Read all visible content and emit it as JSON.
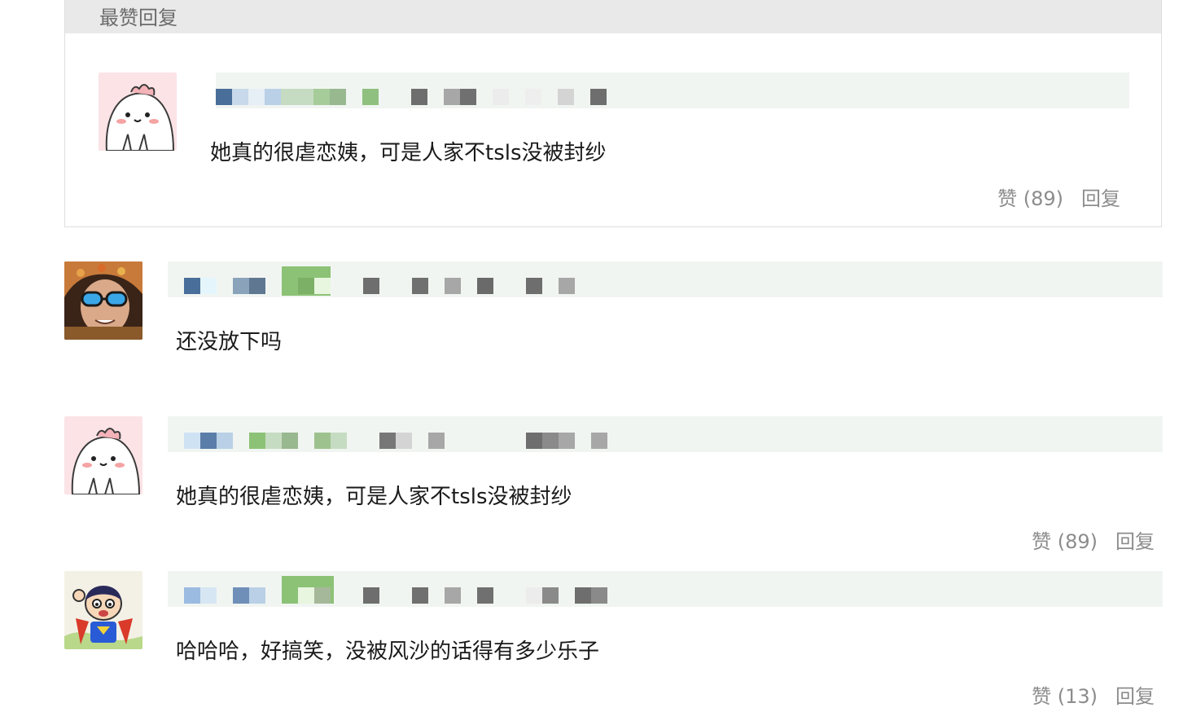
{
  "hot_section": {
    "title": "最赞回复",
    "comment": {
      "text": "她真的很虐恋姨，可是人家不tsls没被封纱",
      "like_label": "赞 (89)",
      "reply_label": "回复"
    }
  },
  "comments": [
    {
      "text": "还没放下吗"
    },
    {
      "text": "她真的很虐恋姨，可是人家不tsls没被封纱",
      "like_label": "赞 (89)",
      "reply_label": "回复"
    },
    {
      "text": "哈哈哈，好搞笑，没被风沙的话得有多少乐子",
      "like_label": "赞 (13)",
      "reply_label": "回复"
    }
  ],
  "colors": {
    "header_bg": "#e9e9e9",
    "username_bar_bg": "#f1f5f2",
    "muted_text": "#8c8c8c"
  }
}
